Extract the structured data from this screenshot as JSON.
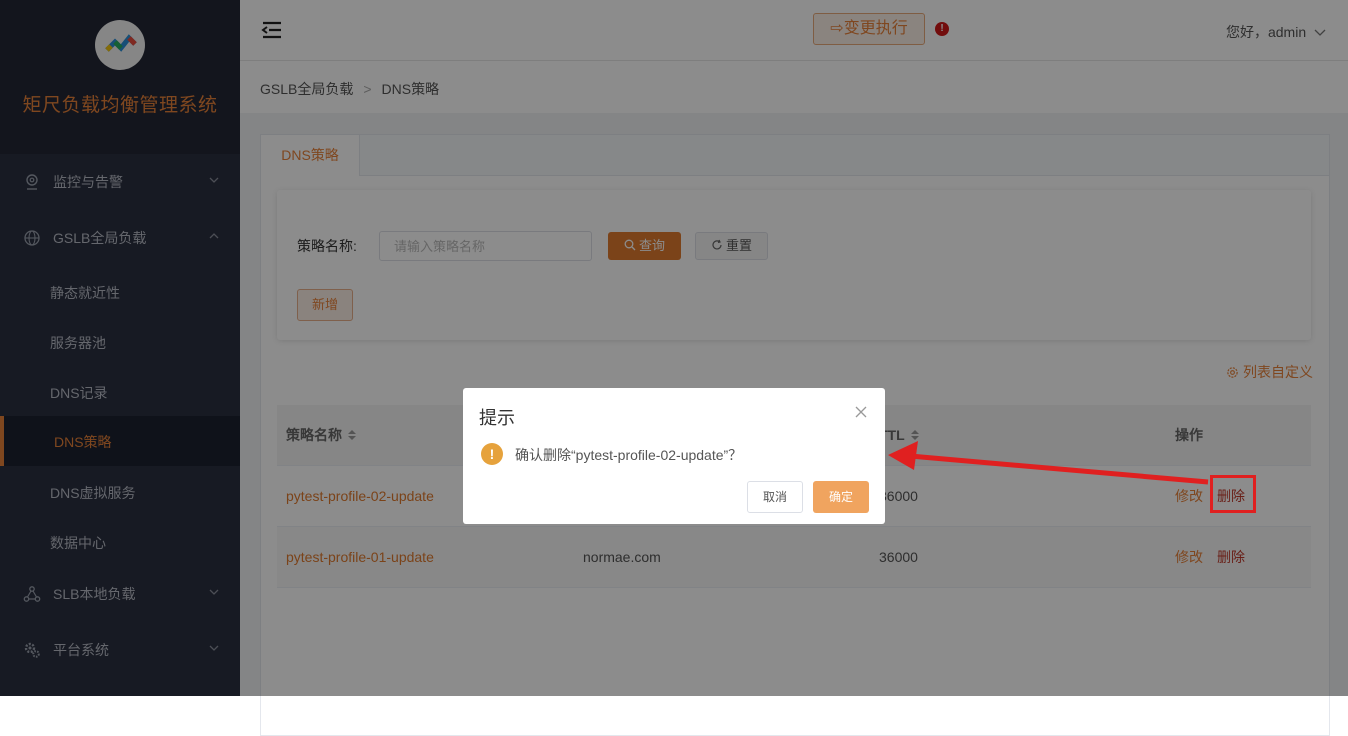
{
  "brand": {
    "title": "矩尺负载均衡管理系统"
  },
  "sidebar": {
    "menus": [
      {
        "label": "监控与告警",
        "icon": "location-pin-icon"
      },
      {
        "label": "GSLB全局负载",
        "icon": "globe-icon"
      },
      {
        "label": "SLB本地负载",
        "icon": "network-nodes-icon"
      },
      {
        "label": "平台系统",
        "icon": "gears-icon"
      }
    ],
    "sub_items": [
      "静态就近性",
      "服务器池",
      "DNS记录",
      "DNS策略",
      "DNS虚拟服务",
      "数据中心"
    ],
    "active_sub": "DNS策略"
  },
  "header": {
    "exec_label": "变更执行",
    "alert": "!",
    "greeting": "您好，admin"
  },
  "breadcrumb": {
    "level1": "GSLB全局负载",
    "level2": "DNS策略"
  },
  "tab": {
    "label": "DNS策略"
  },
  "search": {
    "label": "策略名称:",
    "placeholder": "请输入策略名称",
    "query_label": "查询",
    "reset_label": "重置",
    "add_label": "新增"
  },
  "table": {
    "customize_label": "列表自定义",
    "headers": {
      "name": "策略名称",
      "domain": "",
      "ttl": "TTL",
      "ops": "操作"
    },
    "rows": [
      {
        "name": "pytest-profile-02-update",
        "domain": "",
        "ttl": "36000",
        "edit": "修改",
        "delete": "删除"
      },
      {
        "name": "pytest-profile-01-update",
        "domain": "normae.com",
        "ttl": "36000",
        "edit": "修改",
        "delete": "删除"
      }
    ]
  },
  "dialog": {
    "title": "提示",
    "message": "确认删除“pytest-profile-02-update”？",
    "cancel_label": "取消",
    "ok_label": "确定"
  },
  "colors": {
    "accent": "#e8823a",
    "sidebar_bg": "#2b3040",
    "annotation_red": "#e02020"
  }
}
